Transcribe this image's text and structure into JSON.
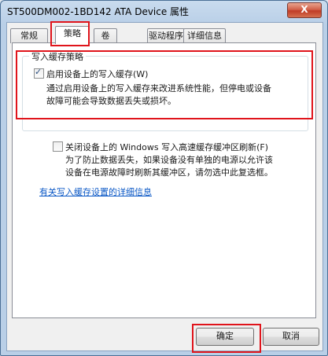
{
  "window": {
    "title": "ST500DM002-1BD142 ATA Device 属性",
    "close_label": "X"
  },
  "tabs": [
    {
      "label": "常规"
    },
    {
      "label": "策略"
    },
    {
      "label": "卷"
    },
    {
      "label": "驱动程序"
    },
    {
      "label": "详细信息"
    }
  ],
  "active_tab": "策略",
  "write_cache": {
    "group_title": "写入缓存策略",
    "enable_label": "启用设备上的写入缓存(W)",
    "enable_checked": true,
    "enable_desc_line1": "通过启用设备上的写入缓存来改进系统性能，但停电或设备",
    "enable_desc_line2": "故障可能会导致数据丢失或损坏。",
    "flush_label": "关闭设备上的 Windows 写入高速缓存缓冲区刷新(F)",
    "flush_checked": false,
    "flush_desc_line1": "为了防止数据丢失，如果设备没有单独的电源以允许该",
    "flush_desc_line2": "设备在电源故障时刷新其缓冲区，请勿选中此复选框。"
  },
  "link_label": "有关写入缓存设置的详细信息",
  "buttons": {
    "ok_label": "确定",
    "cancel_label": "取消"
  },
  "colors": {
    "highlight": "#e0141b",
    "link": "#0b58c6",
    "close_button": "#c03c26"
  }
}
